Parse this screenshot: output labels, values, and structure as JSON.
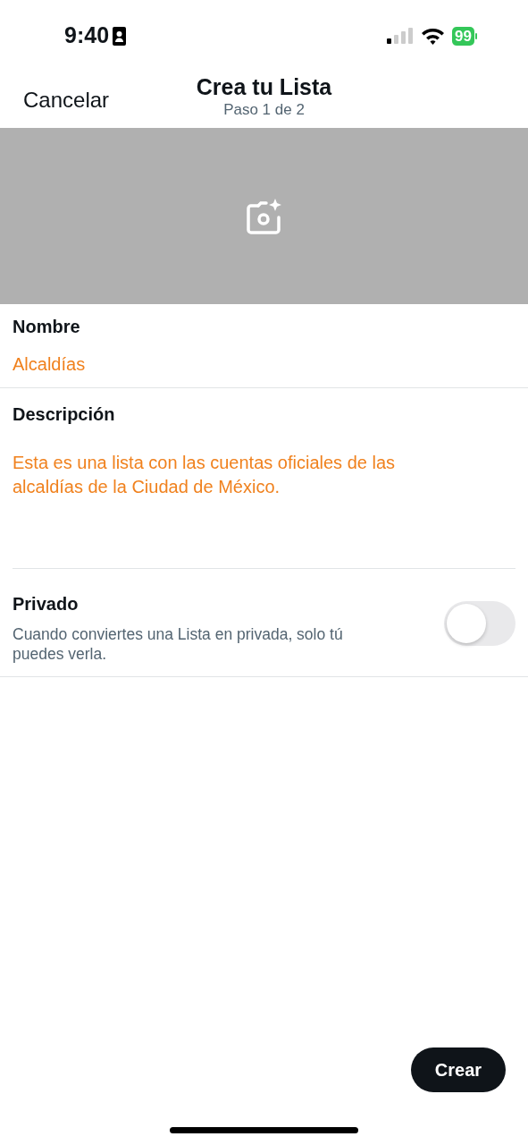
{
  "status_bar": {
    "time": "9:40",
    "battery": "99"
  },
  "header": {
    "cancel": "Cancelar",
    "title": "Crea tu Lista",
    "subtitle": "Paso 1 de 2"
  },
  "fields": [
    {
      "label": "Nombre",
      "value": "Alcaldías"
    },
    {
      "label": "Descripción",
      "value": "Esta es una lista con las cuentas oficiales de las alcaldías de la Ciudad de México."
    }
  ],
  "private": {
    "label": "Privado",
    "description": "Cuando conviertes una Lista en privada, solo tú puedes verla.",
    "on": false
  },
  "create_button": "Crear"
}
